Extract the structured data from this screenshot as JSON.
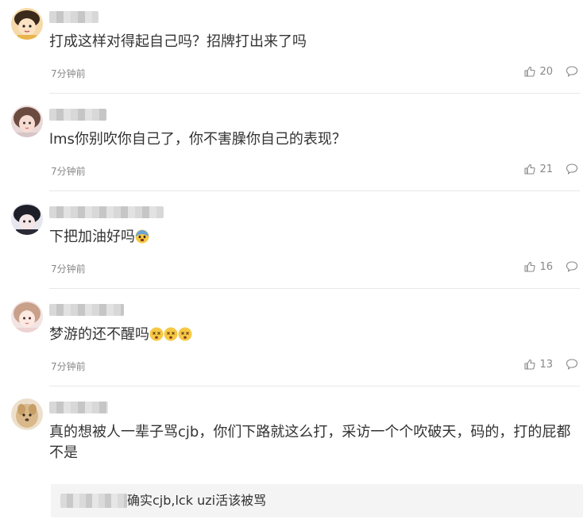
{
  "comments": [
    {
      "text": "打成这样对得起自己吗？招牌打出来了吗",
      "time": "7分钟前",
      "likes": "20"
    },
    {
      "text": "lms你别吹你自己了，你不害臊你自己的表现？",
      "time": "7分钟前",
      "likes": "21"
    },
    {
      "text": "下把加油好吗",
      "time": "7分钟前",
      "likes": "16"
    },
    {
      "text": "梦游的还不醒吗",
      "time": "7分钟前",
      "likes": "13"
    },
    {
      "text": "真的想被人一辈子骂cjb，你们下路就这么打，采访一个个吹破天，码的，打的屁都不是",
      "reply": {
        "text": "确实cjb,lck uzi活该被骂"
      }
    }
  ],
  "icons": {
    "like": "thumbs-up-icon",
    "reply": "comment-bubble-icon",
    "emoji_fear": "fearful-face-emoji",
    "emoji_dizzy": "dizzy-face-emoji"
  },
  "colors": {
    "text": "#333333",
    "meta": "#888888",
    "divider": "#e8e8e8",
    "reply_bg": "#f4f4f4"
  }
}
